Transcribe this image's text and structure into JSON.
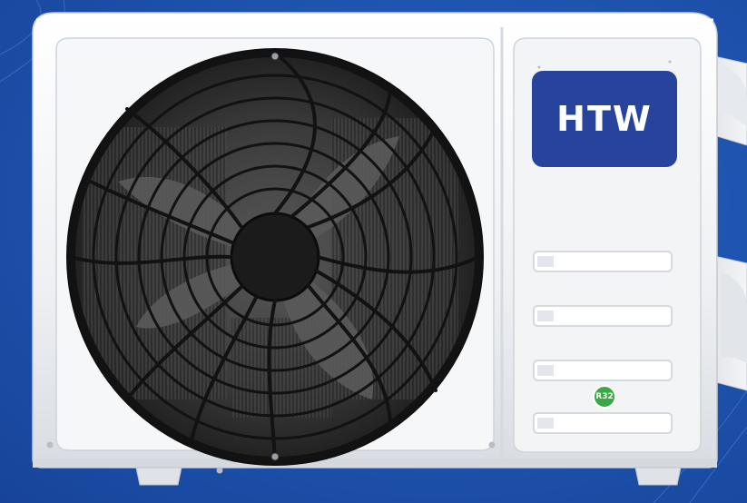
{
  "product": {
    "brand_logo_text": "HTW",
    "refrigerant_badge_text": "R32"
  },
  "colors": {
    "background_blue": "#1f55b0",
    "casing_white": "#f2f3f5",
    "brand_badge_blue": "#27439c",
    "refrigerant_badge_green": "#3aa845",
    "fan_black": "#141414"
  },
  "icons": {
    "fan": "fan-icon",
    "grille": "grille-icon",
    "vents": "vent-slot-icon",
    "refrigerant": "leaf-badge-icon"
  }
}
